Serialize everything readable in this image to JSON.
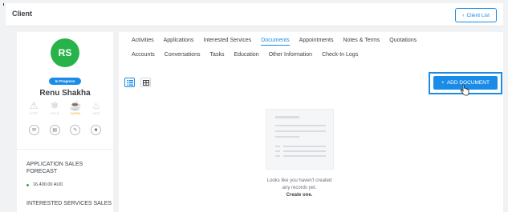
{
  "header": {
    "title": "Client",
    "client_list_label": "Client List"
  },
  "client": {
    "initials": "RS",
    "status": "In Progress",
    "name": "Renu Shakha",
    "temperatures": [
      {
        "label": "LOST",
        "icon": "warning-icon",
        "active": false
      },
      {
        "label": "COLD",
        "icon": "snowflake-icon",
        "active": false
      },
      {
        "label": "WARM",
        "icon": "coffee-icon",
        "active": true
      },
      {
        "label": "HOT",
        "icon": "flame-icon",
        "active": false
      }
    ],
    "actions": [
      "chat-icon",
      "archive-icon",
      "edit-icon",
      "delete-icon"
    ]
  },
  "sidebar": {
    "sales_forecast_title": "APPLICATION SALES FORECAST",
    "sales_forecast_value": "16,400.00 AUD",
    "services_forecast_title": "INTERESTED SERVICES SALES"
  },
  "tabs_row1": [
    "Activities",
    "Applications",
    "Interested Services",
    "Documents",
    "Appointments",
    "Notes & Terms",
    "Quotations"
  ],
  "tabs_row2": [
    "Accounts",
    "Conversations",
    "Tasks",
    "Education",
    "Other Information",
    "Check-In Logs"
  ],
  "active_tab": "Documents",
  "toolbar": {
    "add_document_label": "ADD DOCUMENT"
  },
  "empty_state": {
    "line1": "Looks like you haven't created",
    "line2": "any records yet.",
    "cta": "Create one."
  },
  "colors": {
    "accent": "#1a8ce8",
    "avatar": "#28b34a",
    "warm": "#f5a623"
  }
}
